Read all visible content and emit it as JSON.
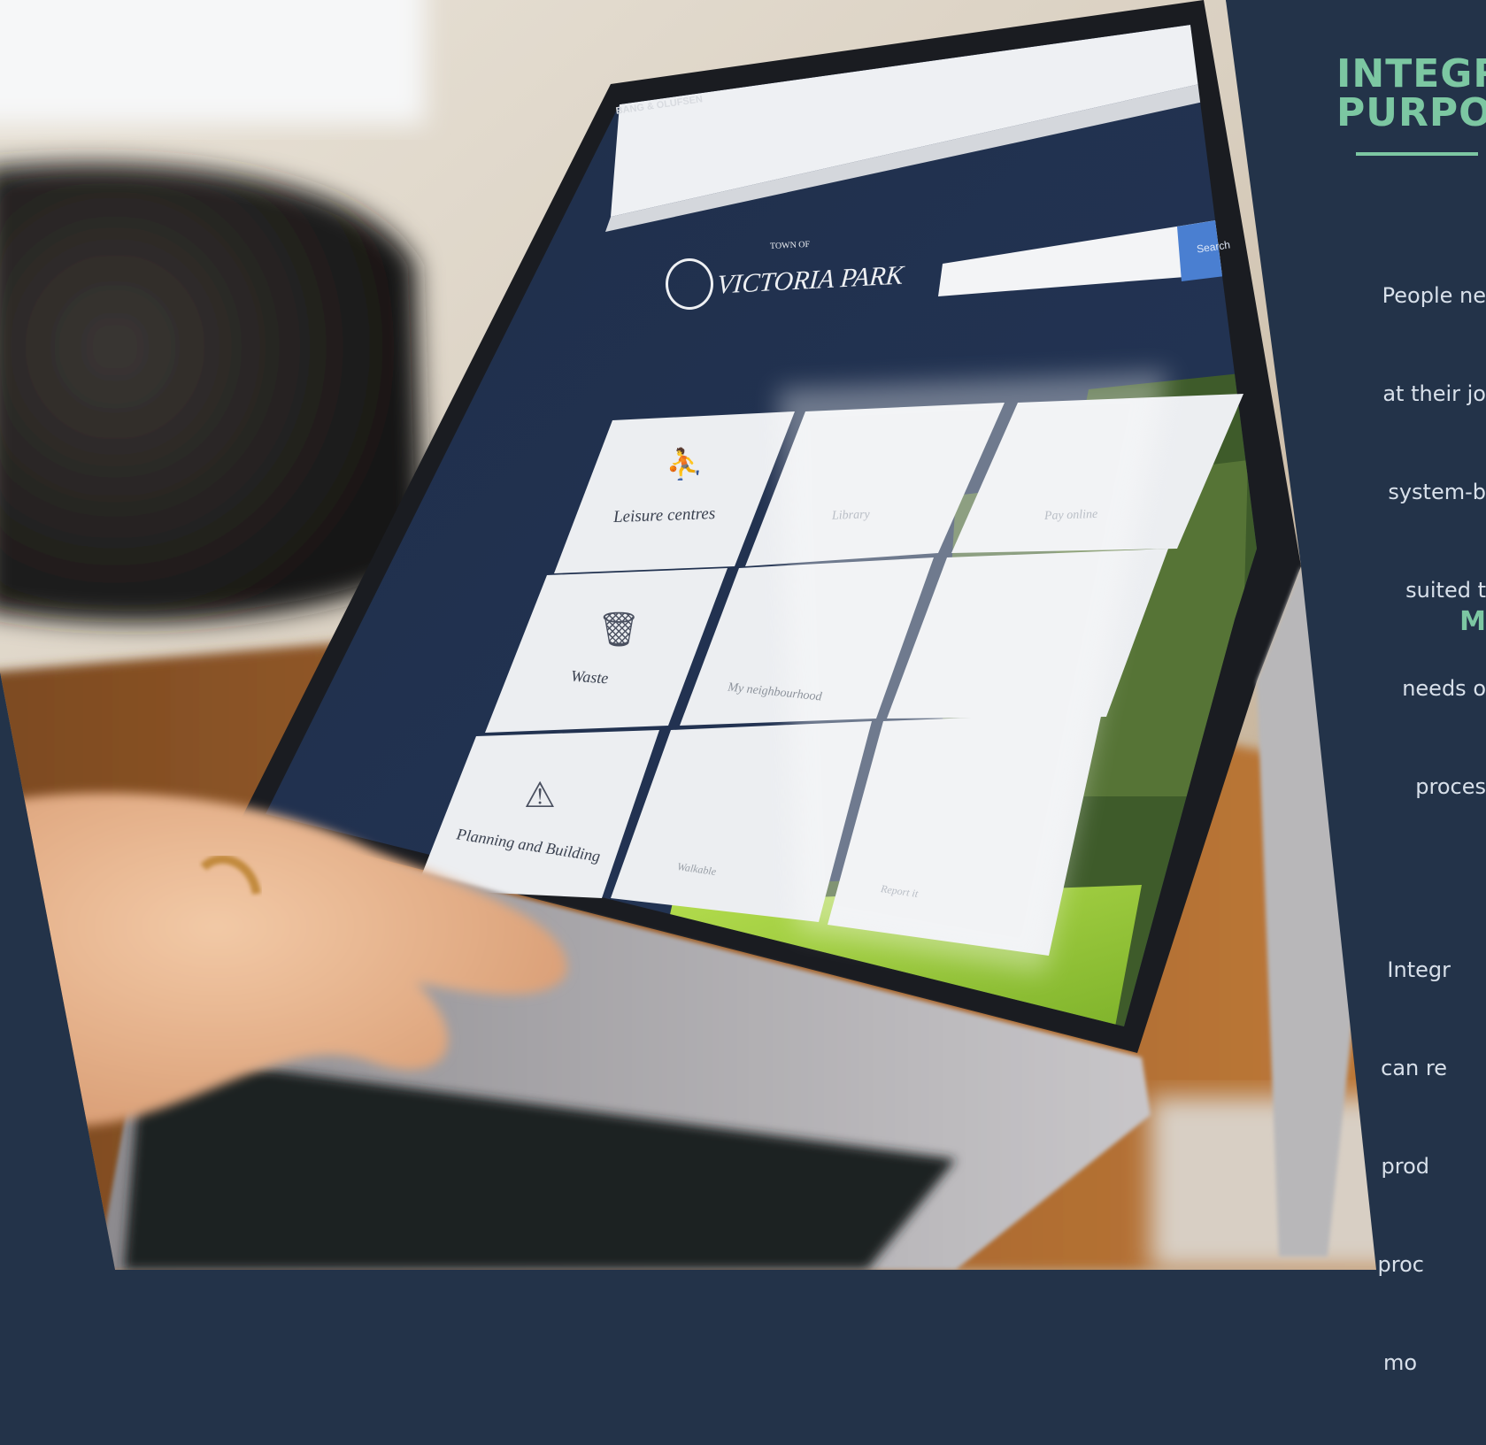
{
  "panel": {
    "title_lines": [
      "INTEGR",
      "PURPO"
    ],
    "body_lines": [
      "People ne",
      "at their jo",
      "system-b",
      "suited t",
      "needs o",
      "proces",
      "",
      "Integr",
      "can re",
      "prod",
      "proc",
      "mo"
    ],
    "subhead": "M",
    "colors": {
      "background": "#233349",
      "accent": "#7cc7a2",
      "text": "#d8e0ea"
    }
  },
  "laptop": {
    "brand": "BANG & OLUFSEN",
    "website": {
      "logo_small": "TOWN OF",
      "logo_name": "VICTORIA PARK",
      "search_button": "Search",
      "tiles": [
        {
          "label": "Leisure centres",
          "icon": "swimmer-icon"
        },
        {
          "label": "Library",
          "icon": "book-icon"
        },
        {
          "label": "Pay online",
          "icon": "payment-icon"
        },
        {
          "label": "Waste",
          "icon": "bin-icon"
        },
        {
          "label": "My neighbourhood",
          "icon": "map-icon"
        },
        {
          "label": "",
          "icon": "icon"
        },
        {
          "label": "Planning and Building",
          "icon": "cone-icon"
        },
        {
          "label": "Walkable",
          "icon": "walk-icon"
        },
        {
          "label": "Report it",
          "icon": "report-icon"
        }
      ]
    }
  }
}
